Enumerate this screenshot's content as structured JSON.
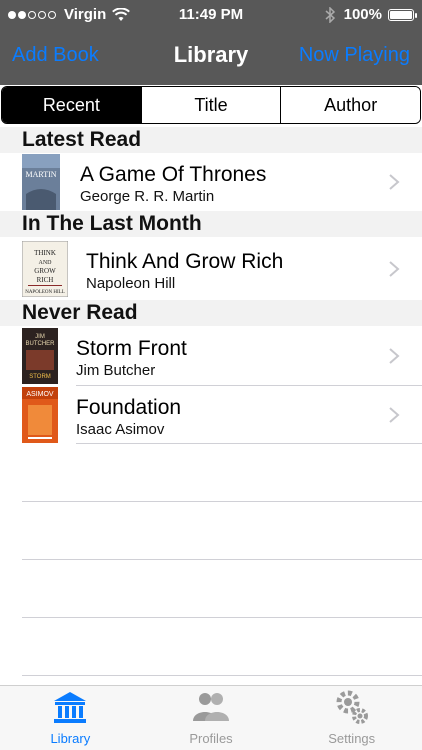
{
  "status": {
    "carrier": "Virgin",
    "time": "11:49 PM",
    "battery": "100%",
    "battery_level": 1.0
  },
  "nav": {
    "left": "Add Book",
    "title": "Library",
    "right": "Now Playing"
  },
  "segments": {
    "items": [
      "Recent",
      "Title",
      "Author"
    ],
    "selected": "Recent"
  },
  "sections": [
    {
      "title": "Latest Read",
      "books": [
        {
          "title": "A Game Of Thrones",
          "author": "George R. R. Martin",
          "cover_text": "MARTIN"
        }
      ]
    },
    {
      "title": "In The Last Month",
      "books": [
        {
          "title": "Think And Grow Rich",
          "author": "Napoleon Hill",
          "cover_text": "THINK AND GROW RICH"
        }
      ]
    },
    {
      "title": "Never Read",
      "books": [
        {
          "title": "Storm Front",
          "author": "Jim Butcher",
          "cover_text": "JIM BUTCHER"
        },
        {
          "title": "Foundation",
          "author": "Isaac Asimov",
          "cover_text": "ASIMOV"
        }
      ]
    }
  ],
  "tabs": [
    {
      "label": "Library",
      "icon": "library-icon",
      "active": true
    },
    {
      "label": "Profiles",
      "icon": "profiles-icon",
      "active": false
    },
    {
      "label": "Settings",
      "icon": "settings-icon",
      "active": false
    }
  ],
  "colors": {
    "accent": "#0a7cff",
    "header_bg": "#585858",
    "section_bg": "#f2f2f2",
    "tab_active": "#0a7cff",
    "tab_inactive": "#9a9a9a"
  }
}
